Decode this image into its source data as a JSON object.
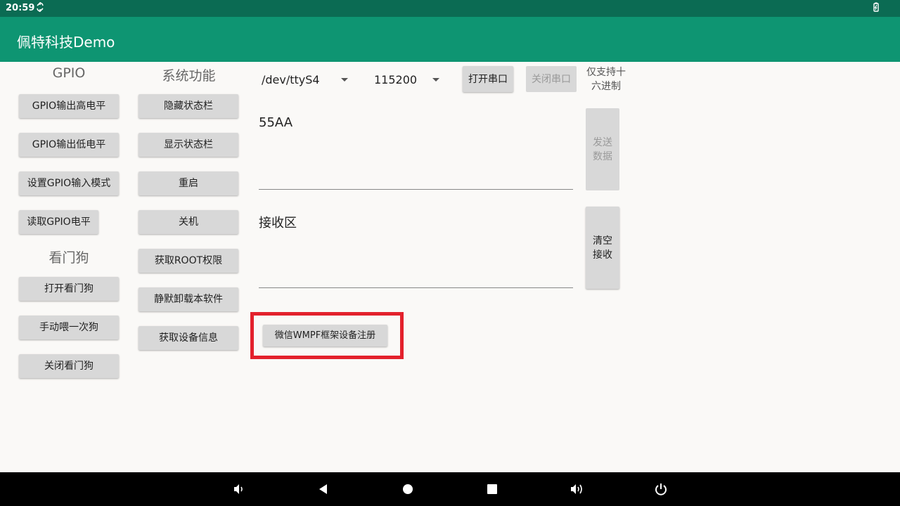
{
  "status_bar": {
    "time": "20:59",
    "icons": [
      "sync-icon",
      "battery-icon"
    ],
    "bg_color": "#0b6b53"
  },
  "app_bar": {
    "title": "佩特科技Demo",
    "bg_color": "#0e9572"
  },
  "gpio": {
    "header": "GPIO",
    "buttons": [
      "GPIO输出高电平",
      "GPIO输出低电平",
      "设置GPIO输入模式",
      "读取GPIO电平"
    ]
  },
  "watchdog": {
    "header": "看门狗",
    "buttons": [
      "打开看门狗",
      "手动喂一次狗",
      "关闭看门狗"
    ]
  },
  "system": {
    "header": "系统功能",
    "buttons": [
      "隐藏状态栏",
      "显示状态栏",
      "重启",
      "关机",
      "获取ROOT权限",
      "静默卸载本软件",
      "获取设备信息"
    ]
  },
  "serial": {
    "port": "/dev/ttyS4",
    "baud": "115200",
    "open_label": "打开串口",
    "close_label": "关闭串口",
    "hex_hint": "仅支持十六进制",
    "send_input": "55AA",
    "send_label": "发送数据",
    "receive_text": "接收区",
    "clear_label": "清空接收"
  },
  "wmpf_button": "微信WMPF框架设备注册",
  "highlight_color": "#e3212c",
  "nav_bar": {
    "icons": [
      "volume-down-icon",
      "back-icon",
      "home-icon",
      "recents-icon",
      "volume-up-icon",
      "power-icon"
    ]
  }
}
